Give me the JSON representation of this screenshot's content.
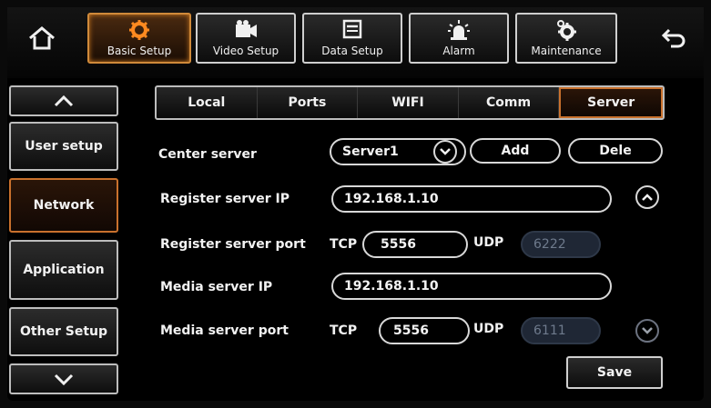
{
  "toolbar": {
    "home_icon": "home-icon",
    "back_icon": "back-icon",
    "tabs": [
      {
        "label": "Basic Setup",
        "icon": "gear-icon"
      },
      {
        "label": "Video Setup",
        "icon": "camera-icon"
      },
      {
        "label": "Data Setup",
        "icon": "data-icon"
      },
      {
        "label": "Alarm",
        "icon": "alarm-icon"
      },
      {
        "label": "Maintenance",
        "icon": "maintenance-icon"
      }
    ]
  },
  "sidebar": {
    "items": [
      {
        "label": "User setup"
      },
      {
        "label": "Network"
      },
      {
        "label": "Application"
      },
      {
        "label": "Other Setup"
      }
    ]
  },
  "subtabs": [
    "Local",
    "Ports",
    "WIFI",
    "Comm",
    "Server"
  ],
  "form": {
    "center_server_label": "Center server",
    "center_server_value": "Server1",
    "add_label": "Add",
    "dele_label": "Dele",
    "register_ip_label": "Register server IP",
    "register_ip_value": "192.168.1.10",
    "register_port_label": "Register server port",
    "tcp_label": "TCP",
    "udp_label": "UDP",
    "register_tcp": "5556",
    "register_udp": "6222",
    "media_ip_label": "Media server IP",
    "media_ip_value": "192.168.1.10",
    "media_port_label": "Media server port",
    "media_tcp": "5556",
    "media_udp": "6111",
    "save_label": "Save"
  },
  "colors": {
    "accent": "#c9712d",
    "field_border": "#d8d8d8",
    "disabled_field": "#1f2735"
  }
}
